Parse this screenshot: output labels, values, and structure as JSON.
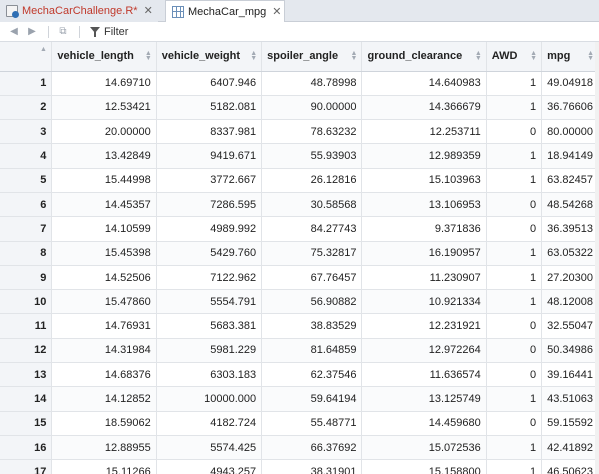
{
  "tabs": [
    {
      "label": "MechaCarChallenge.R*",
      "icon": "r-file-icon",
      "modified": true
    },
    {
      "label": "MechaCar_mpg",
      "icon": "data-grid-icon",
      "active": true
    }
  ],
  "toolbar": {
    "filter_label": "Filter"
  },
  "table": {
    "columns": [
      "vehicle_length",
      "vehicle_weight",
      "spoiler_angle",
      "ground_clearance",
      "AWD",
      "mpg"
    ],
    "rows": [
      [
        "1",
        "14.69710",
        "6407.946",
        "48.78998",
        "14.640983",
        "1",
        "49.04918"
      ],
      [
        "2",
        "12.53421",
        "5182.081",
        "90.00000",
        "14.366679",
        "1",
        "36.76606"
      ],
      [
        "3",
        "20.00000",
        "8337.981",
        "78.63232",
        "12.253711",
        "0",
        "80.00000"
      ],
      [
        "4",
        "13.42849",
        "9419.671",
        "55.93903",
        "12.989359",
        "1",
        "18.94149"
      ],
      [
        "5",
        "15.44998",
        "3772.667",
        "26.12816",
        "15.103963",
        "1",
        "63.82457"
      ],
      [
        "6",
        "14.45357",
        "7286.595",
        "30.58568",
        "13.106953",
        "0",
        "48.54268"
      ],
      [
        "7",
        "14.10599",
        "4989.992",
        "84.27743",
        "9.371836",
        "0",
        "36.39513"
      ],
      [
        "8",
        "15.45398",
        "5429.760",
        "75.32817",
        "16.190957",
        "1",
        "63.05322"
      ],
      [
        "9",
        "14.52506",
        "7122.962",
        "67.76457",
        "11.230907",
        "1",
        "27.20300"
      ],
      [
        "10",
        "15.47860",
        "5554.791",
        "56.90882",
        "10.921334",
        "1",
        "48.12008"
      ],
      [
        "11",
        "14.76931",
        "5683.381",
        "38.83529",
        "12.231921",
        "0",
        "32.55047"
      ],
      [
        "12",
        "14.31984",
        "5981.229",
        "81.64859",
        "12.972264",
        "0",
        "50.34986"
      ],
      [
        "13",
        "14.68376",
        "6303.183",
        "62.37546",
        "11.636574",
        "0",
        "39.16441"
      ],
      [
        "14",
        "14.12852",
        "10000.000",
        "59.64194",
        "13.125749",
        "1",
        "43.51063"
      ],
      [
        "15",
        "18.59062",
        "4182.724",
        "55.48771",
        "14.459680",
        "0",
        "59.15592"
      ],
      [
        "16",
        "12.88955",
        "5574.425",
        "66.37692",
        "15.072536",
        "1",
        "42.41892"
      ],
      [
        "17",
        "15.11266",
        "4943.257",
        "38.31901",
        "15.158800",
        "1",
        "46.50623"
      ]
    ]
  },
  "colors": {
    "modified_tab_text": "#c0392b",
    "header_bg": "#f3f5f8",
    "tabbar_bg": "#e4e8ee"
  }
}
